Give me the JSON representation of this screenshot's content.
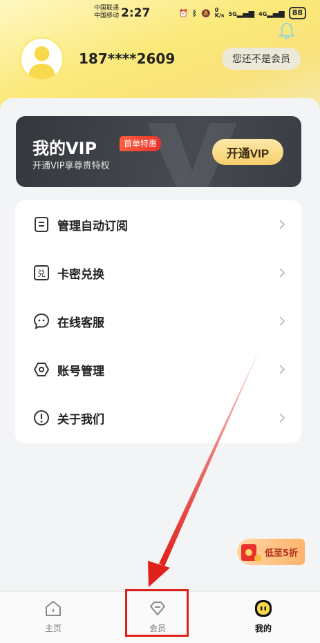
{
  "status": {
    "carrier1": "中国联通",
    "carrier2": "中国移动",
    "time": "2:27",
    "net1": "5G",
    "net2": "4G",
    "battery": "88",
    "speed": "0\nK/s"
  },
  "profile": {
    "phone": "187****2609",
    "member_status": "您还不是会员"
  },
  "vip": {
    "title": "我的VIP",
    "tag": "首单特惠",
    "subtitle": "开通VIP享尊贵特权",
    "button": "开通VIP"
  },
  "menu": [
    {
      "label": "管理自动订阅",
      "icon": "list-icon"
    },
    {
      "label": "卡密兑换",
      "icon": "redeem-icon"
    },
    {
      "label": "在线客服",
      "icon": "chat-icon"
    },
    {
      "label": "账号管理",
      "icon": "hexagon-icon"
    },
    {
      "label": "关于我们",
      "icon": "info-icon"
    }
  ],
  "promo": {
    "label": "低至5折"
  },
  "tabs": [
    {
      "label": "主页"
    },
    {
      "label": "会员"
    },
    {
      "label": "我的"
    }
  ],
  "colors": {
    "accent_yellow": "#fbe97a",
    "vip_dark": "#3b3d44",
    "vip_gold": "#f6cf6b",
    "annotation_red": "#e0201a"
  }
}
